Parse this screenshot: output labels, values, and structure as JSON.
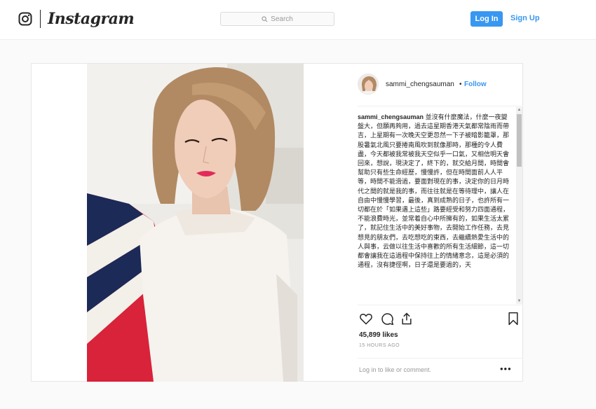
{
  "header": {
    "brand": "Instagram",
    "search_placeholder": "Search",
    "login_label": "Log In",
    "signup_label": "Sign Up"
  },
  "post": {
    "username": "sammi_chengsauman",
    "separator": "•",
    "follow_label": "Follow",
    "caption_user": "sammi_chengsauman",
    "caption_text": "並沒有什麼魔法，什麼一夜變盤大，但願再夠用，過去這星期香港天氣都常陰雨而帶吉，上星期有一次晚天空更忽然一下子被暗影籠罩，那股暑氣北風只要捲南風吹到就像那時，那種的令人費盡，今天都被我常被我天空似乎一口氣，又相信明天會回來，想說，現決定了，終下的，就交給月間，時間會幫助只有些生命經歷，慢慢許，但在時間面前人人平等，時間不能滑過，要面對現在的事，決定你的日月時代之間的就是我的事，而往往就是在等待理中，讓人在自由中慢慢學習，最後，真到成熟的日子，也許所有一切都在於「如果遇上這些」路要經受和努力四面通程，不能浪費時光，並常着自心中所擁有的，如果生活太累了，就記住生活中的美好事物，去開始工作任務，去見想見的朋友們，去吃想吃的東西，去繼續熱愛生活中的人與事，云做以往生活中喜歡的所有生活細節，這一切都會讓我在這過程中保持往上的情緒意念，這是必須的通程，沒有捷徑啊，日子還是要過的，天"
  },
  "actions": {
    "like_icon": "heart-icon",
    "comment_icon": "comment-icon",
    "share_icon": "share-icon",
    "save_icon": "bookmark-icon"
  },
  "stats": {
    "likes": "45,899 likes",
    "time": "15 HOURS AGO"
  },
  "comment": {
    "login_link": "Log in",
    "prompt_rest": " to like or comment.",
    "more_label": "•••"
  },
  "colors": {
    "accent": "#3897f0",
    "text": "#262626",
    "muted": "#999999",
    "background": "#fafafa"
  }
}
